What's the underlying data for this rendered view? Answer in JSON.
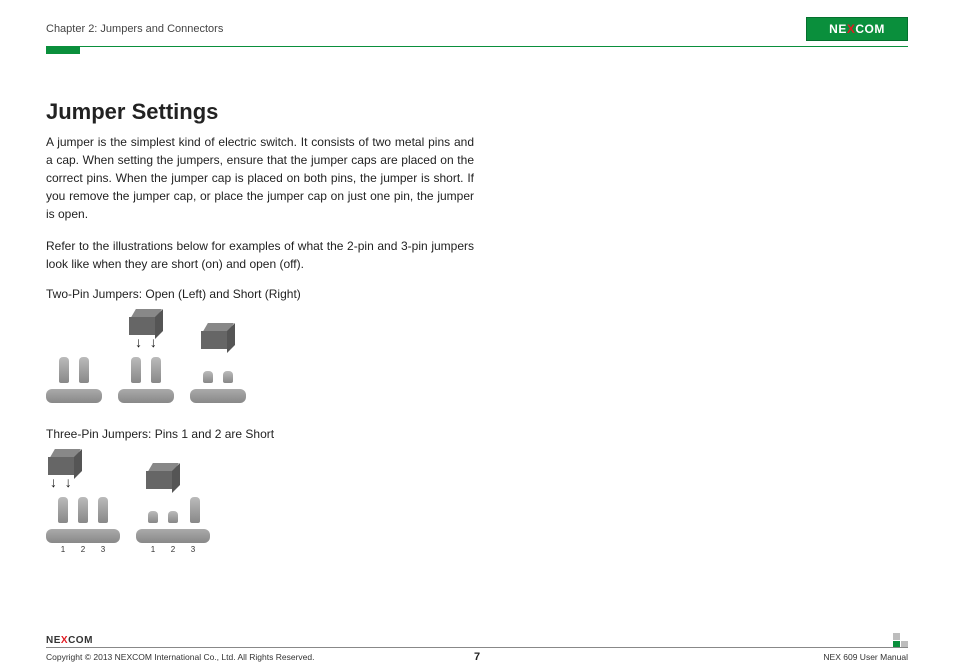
{
  "header": {
    "chapter": "Chapter 2: Jumpers and Connectors",
    "logo_text_a": "NE",
    "logo_text_x": "X",
    "logo_text_b": "COM"
  },
  "content": {
    "title": "Jumper Settings",
    "para1": "A jumper is the simplest kind of electric switch. It consists of two metal pins and a cap. When setting the jumpers, ensure that the jumper caps are placed on the correct pins. When the jumper cap is placed on both pins, the jumper is short. If you remove the jumper cap, or place the jumper cap on just one pin, the jumper is open.",
    "para2": "Refer to the illustrations below for examples of what the 2-pin and 3-pin jumpers look like when they are short (on) and open (off).",
    "caption_two_pin": "Two-Pin Jumpers: Open (Left) and Short (Right)",
    "caption_three_pin": "Three-Pin Jumpers: Pins 1 and 2 are Short",
    "pin_labels": [
      "1",
      "2",
      "3"
    ]
  },
  "footer": {
    "copyright": "Copyright © 2013 NEXCOM International Co., Ltd. All Rights Reserved.",
    "page_number": "7",
    "manual": "NEX 609 User Manual",
    "logo_text_a": "NE",
    "logo_text_x": "X",
    "logo_text_b": "COM"
  }
}
